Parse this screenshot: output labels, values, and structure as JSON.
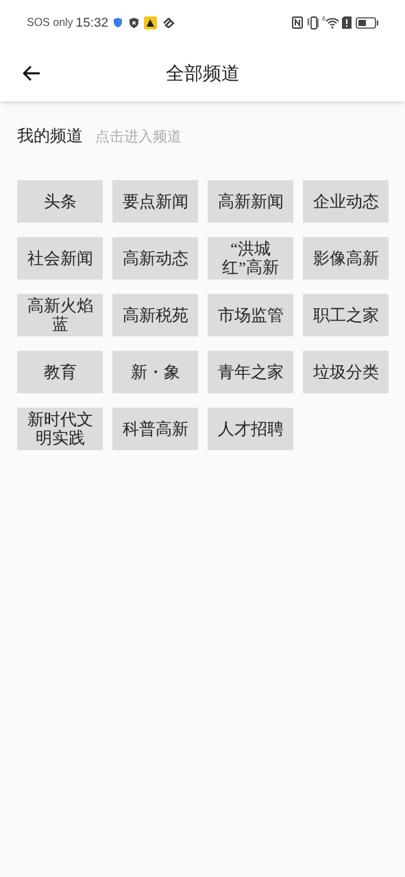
{
  "status_bar": {
    "carrier": "SOS only",
    "time": "15:32",
    "network_badge": "6"
  },
  "header": {
    "title": "全部频道"
  },
  "section": {
    "title": "我的频道",
    "hint": "点击进入频道"
  },
  "channels": [
    {
      "label": "头条"
    },
    {
      "label": "要点新闻"
    },
    {
      "label": "高新新闻"
    },
    {
      "label": "企业动态"
    },
    {
      "label": "社会新闻"
    },
    {
      "label": "高新动态"
    },
    {
      "label": "“洪城红”高新"
    },
    {
      "label": "影像高新"
    },
    {
      "label": "高新火焰蓝"
    },
    {
      "label": "高新税苑"
    },
    {
      "label": "市场监管"
    },
    {
      "label": "职工之家"
    },
    {
      "label": "教育"
    },
    {
      "label": "新・象"
    },
    {
      "label": "青年之家"
    },
    {
      "label": "垃圾分类"
    },
    {
      "label": "新时代文明实践"
    },
    {
      "label": "科普高新"
    },
    {
      "label": "人才招聘"
    }
  ]
}
